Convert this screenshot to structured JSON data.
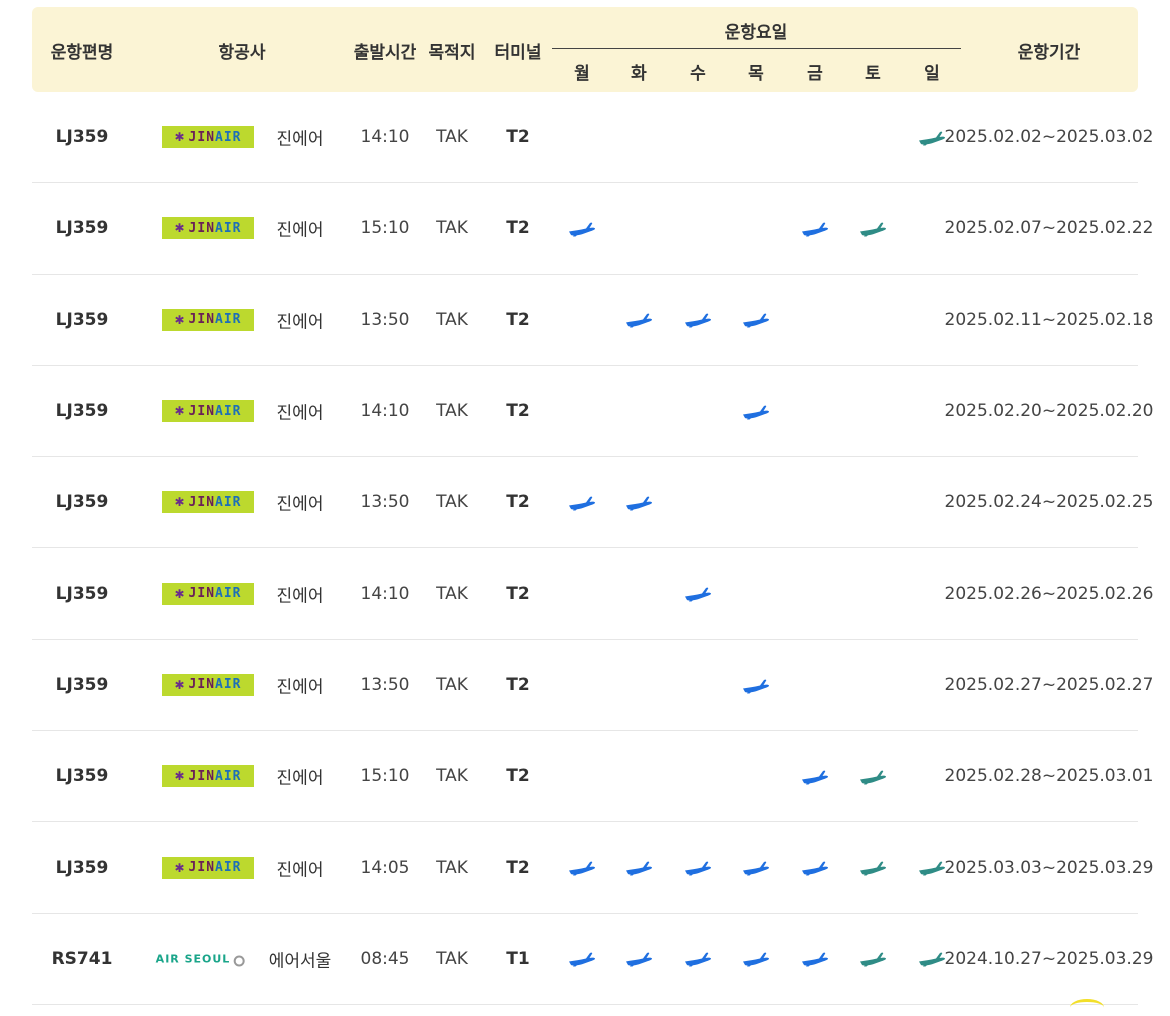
{
  "header": {
    "flight": "운항편명",
    "airline": "항공사",
    "departure": "출발시간",
    "destination": "목적지",
    "terminal": "터미널",
    "days_title": "운항요일",
    "days": [
      "월",
      "화",
      "수",
      "목",
      "금",
      "토",
      "일"
    ],
    "period": "운항기간"
  },
  "colors": {
    "header_bg": "#fbf4d5",
    "plane_blue": "#1f6fe0",
    "plane_green": "#2f8c86"
  },
  "rows": [
    {
      "flight": "LJ359",
      "logo": "jinair-logo",
      "airline": "진에어",
      "time": "14:10",
      "dest": "TAK",
      "terminal": "T2",
      "days": [
        "",
        "",
        "",
        "",
        "",
        "",
        "green"
      ],
      "period": "2025.02.02~2025.03.02"
    },
    {
      "flight": "LJ359",
      "logo": "jinair-logo",
      "airline": "진에어",
      "time": "15:10",
      "dest": "TAK",
      "terminal": "T2",
      "days": [
        "blue",
        "",
        "",
        "",
        "blue",
        "green",
        ""
      ],
      "period": "2025.02.07~2025.02.22"
    },
    {
      "flight": "LJ359",
      "logo": "jinair-logo",
      "airline": "진에어",
      "time": "13:50",
      "dest": "TAK",
      "terminal": "T2",
      "days": [
        "",
        "blue",
        "blue",
        "blue",
        "",
        "",
        ""
      ],
      "period": "2025.02.11~2025.02.18"
    },
    {
      "flight": "LJ359",
      "logo": "jinair-logo",
      "airline": "진에어",
      "time": "14:10",
      "dest": "TAK",
      "terminal": "T2",
      "days": [
        "",
        "",
        "",
        "blue",
        "",
        "",
        ""
      ],
      "period": "2025.02.20~2025.02.20"
    },
    {
      "flight": "LJ359",
      "logo": "jinair-logo",
      "airline": "진에어",
      "time": "13:50",
      "dest": "TAK",
      "terminal": "T2",
      "days": [
        "blue",
        "blue",
        "",
        "",
        "",
        "",
        ""
      ],
      "period": "2025.02.24~2025.02.25"
    },
    {
      "flight": "LJ359",
      "logo": "jinair-logo",
      "airline": "진에어",
      "time": "14:10",
      "dest": "TAK",
      "terminal": "T2",
      "days": [
        "",
        "",
        "blue",
        "",
        "",
        "",
        ""
      ],
      "period": "2025.02.26~2025.02.26"
    },
    {
      "flight": "LJ359",
      "logo": "jinair-logo",
      "airline": "진에어",
      "time": "13:50",
      "dest": "TAK",
      "terminal": "T2",
      "days": [
        "",
        "",
        "",
        "blue",
        "",
        "",
        ""
      ],
      "period": "2025.02.27~2025.02.27"
    },
    {
      "flight": "LJ359",
      "logo": "jinair-logo",
      "airline": "진에어",
      "time": "15:10",
      "dest": "TAK",
      "terminal": "T2",
      "days": [
        "",
        "",
        "",
        "",
        "blue",
        "green",
        ""
      ],
      "period": "2025.02.28~2025.03.01"
    },
    {
      "flight": "LJ359",
      "logo": "jinair-logo",
      "airline": "진에어",
      "time": "14:05",
      "dest": "TAK",
      "terminal": "T2",
      "days": [
        "blue",
        "blue",
        "blue",
        "blue",
        "blue",
        "green",
        "green"
      ],
      "period": "2025.03.03~2025.03.29"
    },
    {
      "flight": "RS741",
      "logo": "airseoul-logo",
      "airline": "에어서울",
      "time": "08:45",
      "dest": "TAK",
      "terminal": "T1",
      "days": [
        "blue",
        "blue",
        "blue",
        "blue",
        "blue",
        "green",
        "green"
      ],
      "period": "2024.10.27~2025.03.29"
    }
  ],
  "logos": {
    "jinair": {
      "mark": "✱",
      "text_jin": "JIN",
      "text_air": "AIR"
    },
    "airseoul": {
      "text": "AIR SEOUL"
    }
  }
}
